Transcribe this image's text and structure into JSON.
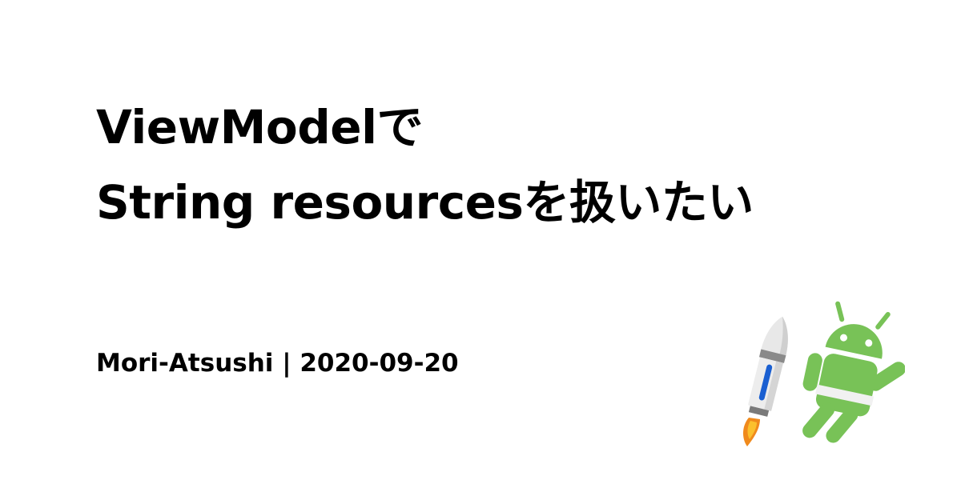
{
  "title": {
    "line1": "ViewModelで",
    "line2": "String resourcesを扱いたい"
  },
  "meta": {
    "author": "Mori-Atsushi",
    "separator": "|",
    "date": "2020-09-20"
  },
  "illustration": {
    "icon": "android-jetpack-robot-icon",
    "robot_color": "#78C257",
    "rocket_body_color": "#E6E6E6",
    "rocket_accent_color": "#1A5FD1",
    "flame_color": "#F08A1C"
  }
}
